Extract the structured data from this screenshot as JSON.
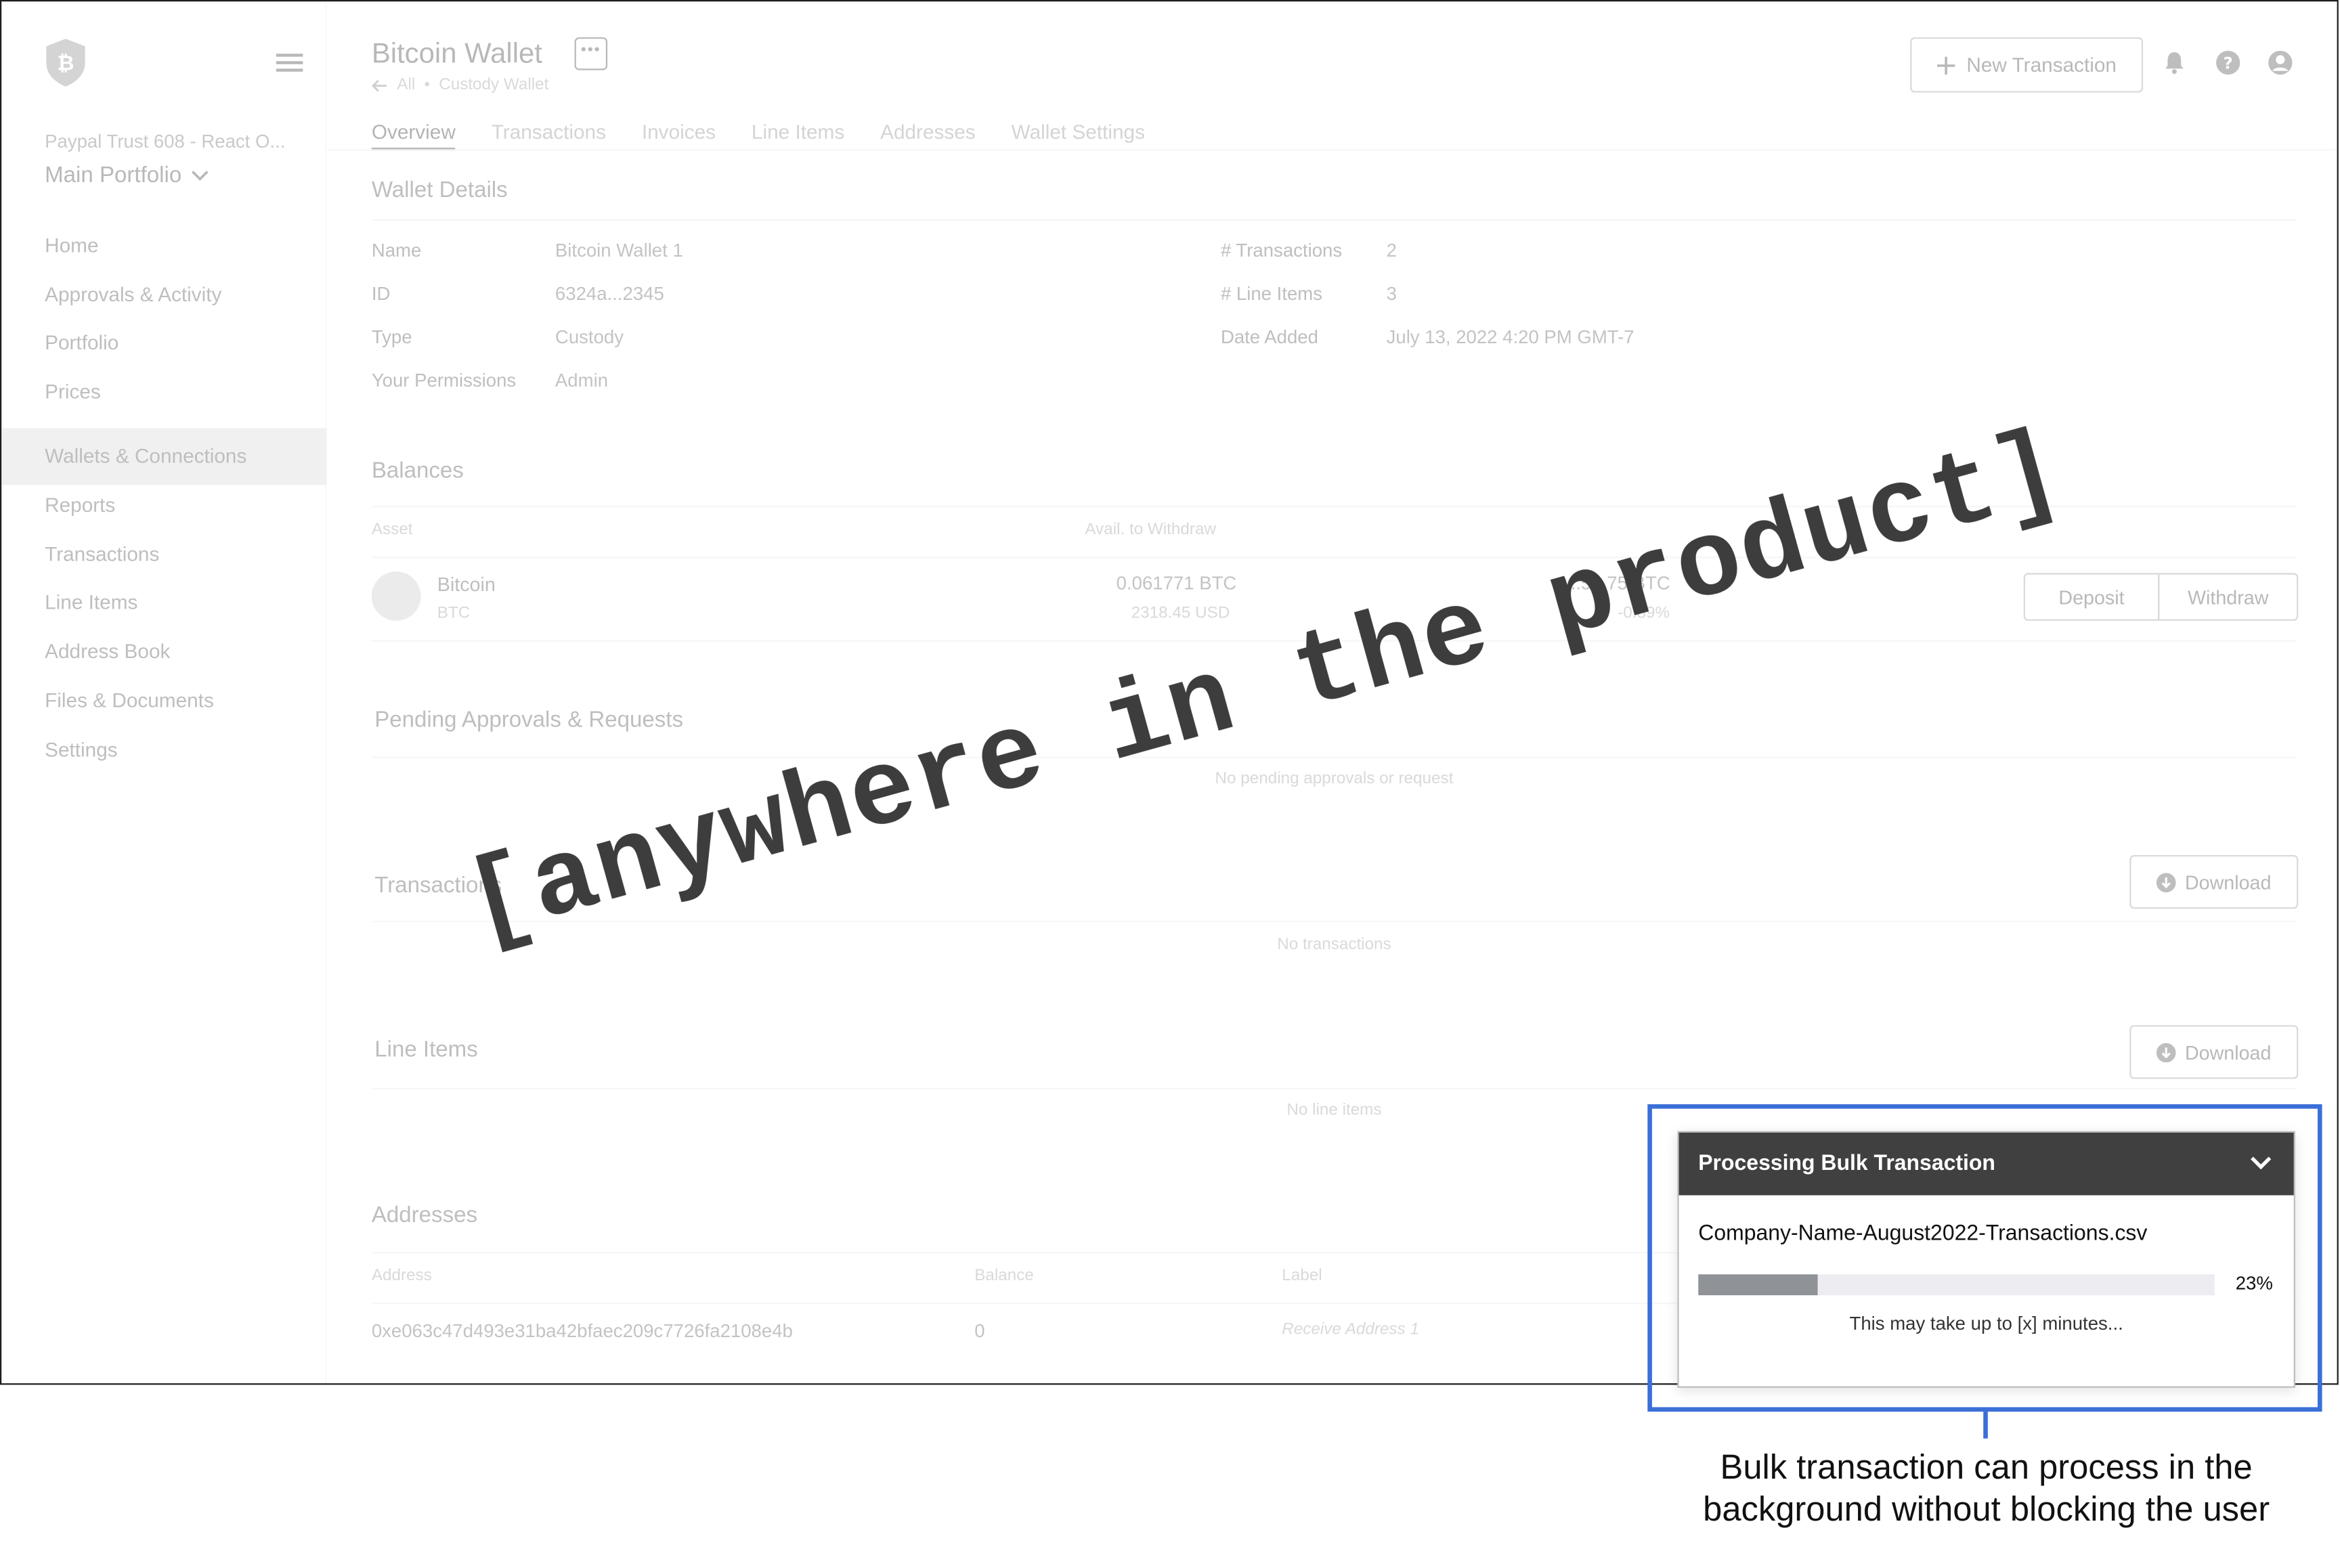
{
  "sidebar": {
    "org_name": "Paypal Trust 608 - React O...",
    "portfolio": "Main Portfolio",
    "nav": [
      {
        "label": "Home",
        "active": false
      },
      {
        "label": "Approvals & Activity",
        "active": false
      },
      {
        "label": "Portfolio",
        "active": false
      },
      {
        "label": "Prices",
        "active": false
      },
      {
        "label": "Wallets & Connections",
        "active": true
      },
      {
        "label": "Reports",
        "active": false
      },
      {
        "label": "Transactions",
        "active": false
      },
      {
        "label": "Line Items",
        "active": false
      },
      {
        "label": "Address Book",
        "active": false
      },
      {
        "label": "Files & Documents",
        "active": false
      },
      {
        "label": "Settings",
        "active": false
      }
    ]
  },
  "header": {
    "title": "Bitcoin Wallet",
    "back_label": "All",
    "subtitle": "Custody Wallet",
    "new_tx_label": "New Transaction",
    "tabs": [
      {
        "label": "Overview",
        "active": true
      },
      {
        "label": "Transactions",
        "active": false
      },
      {
        "label": "Invoices",
        "active": false
      },
      {
        "label": "Line Items",
        "active": false
      },
      {
        "label": "Addresses",
        "active": false
      },
      {
        "label": "Wallet Settings",
        "active": false
      }
    ]
  },
  "details": {
    "title": "Wallet Details",
    "name_label": "Name",
    "name_value": "Bitcoin Wallet 1",
    "id_label": "ID",
    "id_value": "6324a...2345",
    "type_label": "Type",
    "type_value": "Custody",
    "perm_label": "Your Permissions",
    "perm_value": "Admin",
    "tx_label": "# Transactions",
    "tx_value": "2",
    "li_label": "# Line Items",
    "li_value": "3",
    "date_label": "Date Added",
    "date_value": "July 13, 2022 4:20 PM GMT-7"
  },
  "balances": {
    "title": "Balances",
    "col_asset": "Asset",
    "col_avail": "Avail. to Withdraw",
    "asset_name": "Bitcoin",
    "asset_ticker": "BTC",
    "avail_btc": "0.061771 BTC",
    "avail_usd": "2318.45 USD",
    "total_btc": "...56.75 BTC",
    "change": "-0.89%",
    "deposit_label": "Deposit",
    "withdraw_label": "Withdraw"
  },
  "pending": {
    "title": "Pending Approvals & Requests",
    "empty": "No pending approvals or request"
  },
  "transactions": {
    "title": "Transactions",
    "empty": "No transactions",
    "download_label": "Download"
  },
  "line_items": {
    "title": "Line Items",
    "empty": "No line items",
    "download_label": "Download"
  },
  "addresses": {
    "title": "Addresses",
    "col_address": "Address",
    "col_balance": "Balance",
    "col_label": "Label",
    "row_address": "0xe063c47d493e31ba42bfaec209c7726fa2108e4b",
    "row_balance": "0",
    "row_label": "Receive Address 1"
  },
  "overlay_text": "[anywhere in the product]",
  "processing": {
    "title": "Processing Bulk Transaction",
    "file": "Company-Name-August2022-Transactions.csv",
    "progress": 0.23,
    "percent_label": "23%",
    "note": "This may take up to [x] minutes..."
  },
  "caption": {
    "line1": "Bulk transaction can process in the",
    "line2": "background without blocking the user"
  },
  "colors": {
    "highlight": "#3a6fd8",
    "panel_header": "#404040",
    "progress_fill": "#8f9398"
  }
}
